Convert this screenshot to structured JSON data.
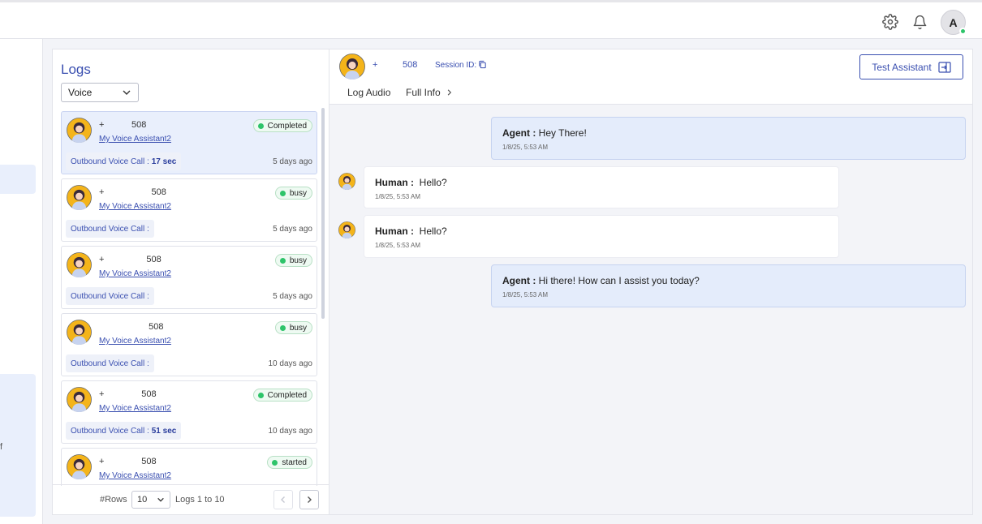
{
  "header": {
    "settings_icon": "gear-icon",
    "notifications_icon": "bell-icon",
    "avatar_initial": "A"
  },
  "sidebar": {
    "fragment": "f"
  },
  "logs": {
    "title": "Logs",
    "filter_value": "Voice",
    "items": [
      {
        "phone": "+           508",
        "assistant": "My Voice Assistant2",
        "status": "Completed",
        "call_type": "Outbound Voice Call :",
        "duration": "17 sec",
        "when": "5 days ago"
      },
      {
        "phone": "+                   508",
        "assistant": "My Voice Assistant2",
        "status": "busy",
        "call_type": "Outbound Voice Call :",
        "duration": "",
        "when": "5 days ago"
      },
      {
        "phone": "+                 508",
        "assistant": "My Voice Assistant2",
        "status": "busy",
        "call_type": "Outbound Voice Call :",
        "duration": "",
        "when": "5 days ago"
      },
      {
        "phone": "                    508",
        "assistant": "My Voice Assistant2",
        "status": "busy",
        "call_type": "Outbound Voice Call :",
        "duration": "",
        "when": "10 days ago"
      },
      {
        "phone": "+               508",
        "assistant": "My Voice Assistant2",
        "status": "Completed",
        "call_type": "Outbound Voice Call :",
        "duration": "51 sec",
        "when": "10 days ago"
      },
      {
        "phone": "+               508",
        "assistant": "My Voice Assistant2",
        "status": "started",
        "call_type": "",
        "duration": "",
        "when": ""
      }
    ],
    "rows_label": "#Rows",
    "rows_value": "10",
    "range_label": "Logs 1 to 10"
  },
  "detail": {
    "phone": "+          508",
    "session_label": "Session ID:",
    "tabs": [
      "Log Audio",
      "Full Info"
    ],
    "test_button_label": "Test Assistant",
    "messages": [
      {
        "role": "agent",
        "speaker": "Agent :",
        "text": "Hey There!",
        "time": "1/8/25, 5:53 AM"
      },
      {
        "role": "human",
        "speaker": "Human :",
        "text": "Hello?",
        "time": "1/8/25, 5:53 AM"
      },
      {
        "role": "human",
        "speaker": "Human :",
        "text": "Hello?",
        "time": "1/8/25, 5:53 AM"
      },
      {
        "role": "agent",
        "speaker": "Agent :",
        "text": "Hi there! How can I assist you today?",
        "time": "1/8/25, 5:53 AM"
      }
    ]
  },
  "colors": {
    "accent": "#3a4fb0",
    "agent_bubble": "#e4ecfb",
    "status_green": "#2ec46a"
  }
}
